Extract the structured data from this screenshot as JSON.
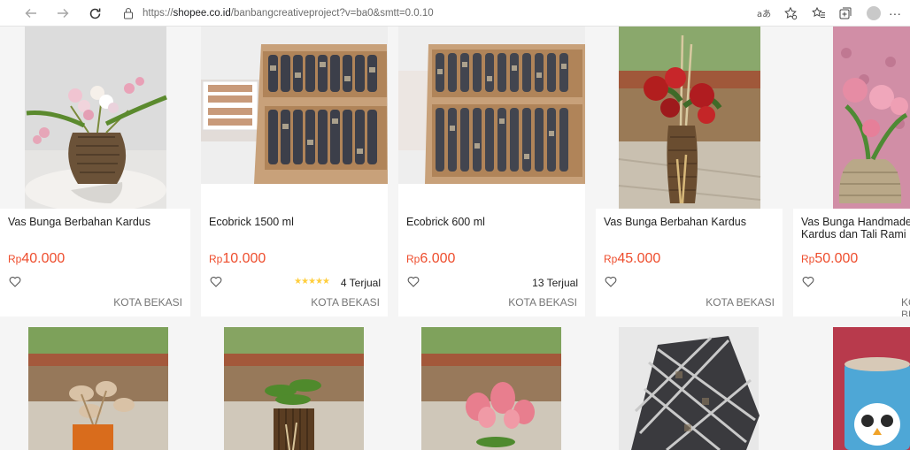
{
  "browser": {
    "url_prefix": "https://",
    "url_host": "shopee.co.id",
    "url_path": "/banbangcreativeproject?v=ba0&smtt=0.0.10",
    "icons": [
      "back-icon",
      "forward-icon",
      "refresh-icon",
      "site-info-icon",
      "read-aloud-icon",
      "favorite-add-icon",
      "favorites-icon",
      "collections-icon",
      "profile-icon",
      "more-icon"
    ]
  },
  "products": [
    {
      "name": "Vas Bunga Berbahan Kardus",
      "currency": "Rp",
      "price": "40.000",
      "stars": "",
      "sold": "",
      "location": "KOTA BEKASI"
    },
    {
      "name": "Ecobrick 1500 ml",
      "currency": "Rp",
      "price": "10.000",
      "stars": "★★★★★",
      "sold": "4 Terjual",
      "location": "KOTA BEKASI"
    },
    {
      "name": "Ecobrick 600 ml",
      "currency": "Rp",
      "price": "6.000",
      "stars": "",
      "sold": "13 Terjual",
      "location": "KOTA BEKASI"
    },
    {
      "name": "Vas Bunga Berbahan Kardus",
      "currency": "Rp",
      "price": "45.000",
      "stars": "",
      "sold": "",
      "location": "KOTA BEKASI"
    },
    {
      "name": "Vas Bunga Handmade Kardus dan Tali Rami",
      "currency": "Rp",
      "price": "50.000",
      "stars": "",
      "sold": "",
      "location": "KOTA BEKASI"
    }
  ],
  "colors": {
    "price": "#ee4d2d",
    "stars": "#ffce3d",
    "page_bg": "#f5f5f5"
  }
}
